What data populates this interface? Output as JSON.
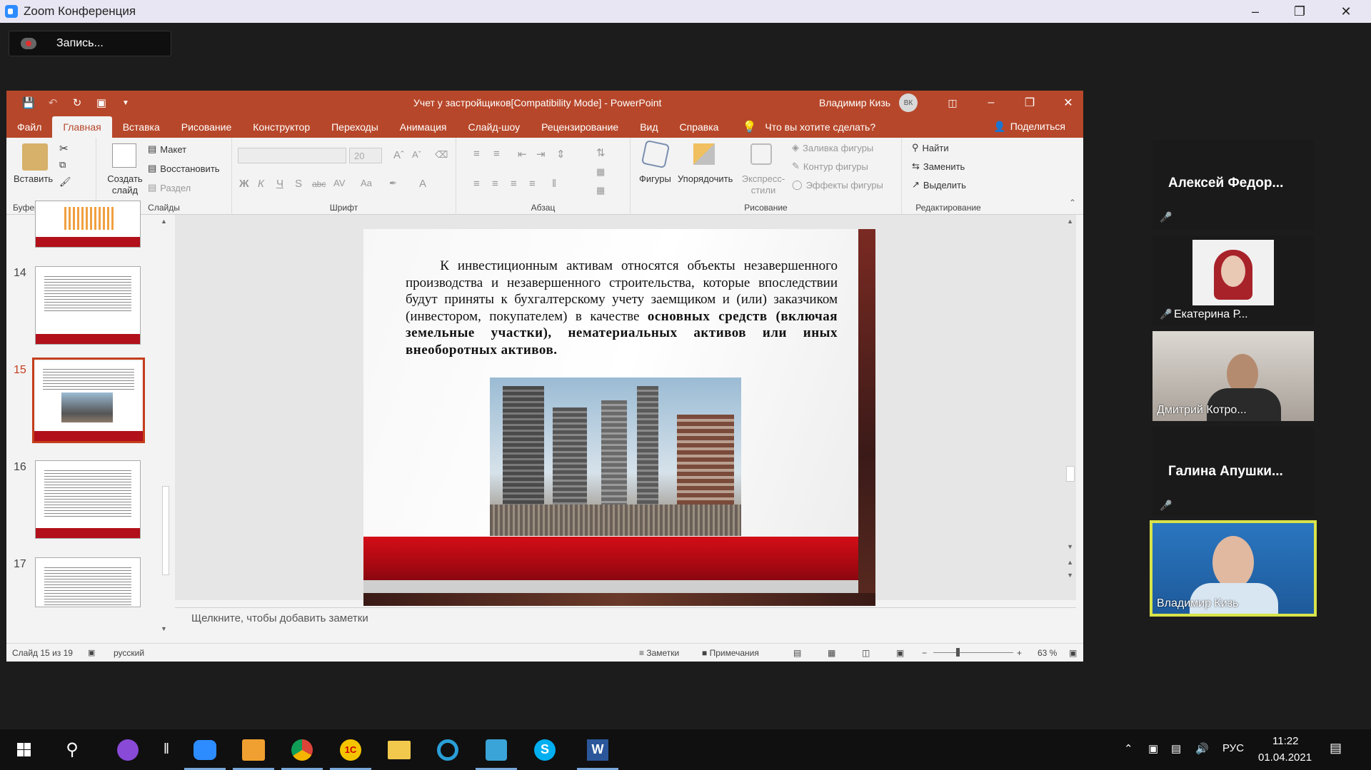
{
  "zoom": {
    "title": "Zoom Конференция",
    "record_label": "Запись..."
  },
  "ppt": {
    "doc_title": "Учет у застройщиков[Compatibility Mode]  -  PowerPoint",
    "user_name": "Владимир Кизь",
    "user_initials": "ВК",
    "tabs": [
      "Файл",
      "Главная",
      "Вставка",
      "Рисование",
      "Конструктор",
      "Переходы",
      "Анимация",
      "Слайд-шоу",
      "Рецензирование",
      "Вид",
      "Справка"
    ],
    "active_tab": "Главная",
    "tell_me": "Что вы хотите сделать?",
    "share": "Поделиться",
    "ribbon": {
      "paste": "Вставить",
      "clipboard_group": "Буфер обмена",
      "new_slide": "Создать слайд",
      "layout": "Макет",
      "reset": "Восстановить",
      "section": "Раздел",
      "slides_group": "Слайды",
      "font_size": "20",
      "font_group": "Шрифт",
      "bold": "Ж",
      "italic": "К",
      "underline": "Ч",
      "strike": "S",
      "abc": "abc",
      "spacing": "AV",
      "case": "Aa",
      "fontcolor": "A",
      "paragraph_group": "Абзац",
      "shapes": "Фигуры",
      "arrange": "Упорядочить",
      "quick_styles": "Экспресс-стили",
      "shape_fill": "Заливка фигуры",
      "shape_outline": "Контур фигуры",
      "shape_effects": "Эффекты фигуры",
      "drawing_group": "Рисование",
      "find": "Найти",
      "replace": "Заменить",
      "select": "Выделить",
      "editing_group": "Редактирование"
    },
    "thumbnails": [
      {
        "num": "14"
      },
      {
        "num": "15"
      },
      {
        "num": "16"
      },
      {
        "num": "17"
      }
    ],
    "slide": {
      "text_regular": "К инвестиционным активам относятся объекты незавершенного производства и незавершенного строительства, которые впоследствии будут приняты к бухгалтерскому учету заемщиком и (или) заказчиком (инвестором, покупателем) в качестве ",
      "text_bold": "основных средств (включая земельные участки), нематериальных активов или иных внеоборотных активов."
    },
    "notes_placeholder": "Щелкните, чтобы добавить заметки",
    "status": {
      "slide": "Слайд 15 из 19",
      "lang": "русский",
      "notes": "Заметки",
      "comments": "Примечания",
      "zoom": "63 %"
    }
  },
  "participants": [
    {
      "name": "Алексей  Федор...",
      "muted": true,
      "video": false
    },
    {
      "name": "Екатерина Р...",
      "muted": true,
      "video": true
    },
    {
      "name": "Дмитрий Котро...",
      "muted": false,
      "video": true
    },
    {
      "name": "Галина  Апушки...",
      "muted": true,
      "video": false
    },
    {
      "name": "Владимир Кизь",
      "muted": false,
      "video": true,
      "active_speaker": true
    }
  ],
  "taskbar": {
    "lang": "РУС",
    "time": "11:22",
    "date": "01.04.2021"
  }
}
